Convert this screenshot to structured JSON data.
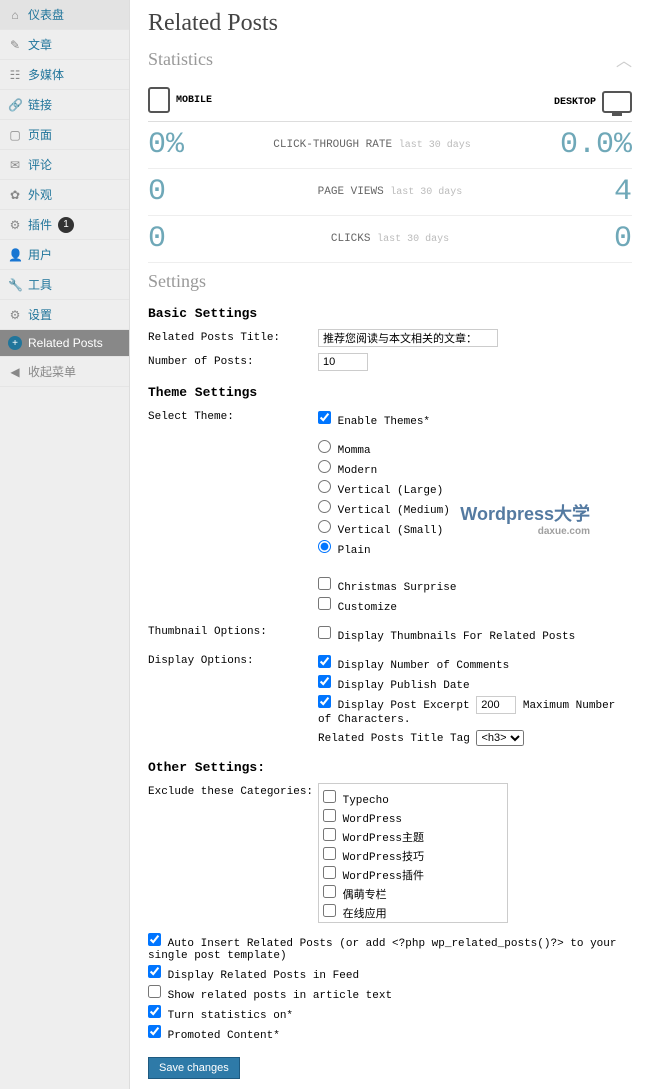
{
  "sidebar": {
    "items": [
      {
        "icon": "⌂",
        "label": "仪表盘"
      },
      {
        "icon": "✎",
        "label": "文章"
      },
      {
        "icon": "☷",
        "label": "多媒体"
      },
      {
        "icon": "🔗",
        "label": "链接"
      },
      {
        "icon": "▢",
        "label": "页面"
      },
      {
        "icon": "✉",
        "label": "评论"
      },
      {
        "icon": "✿",
        "label": "外观"
      },
      {
        "icon": "⚙",
        "label": "插件",
        "badge": "1"
      },
      {
        "icon": "👤",
        "label": "用户"
      },
      {
        "icon": "🔧",
        "label": "工具"
      },
      {
        "icon": "⚙",
        "label": "设置"
      }
    ],
    "active": {
      "icon": "+",
      "label": "Related Posts"
    },
    "collapse": "收起菜单"
  },
  "page_title": "Related Posts",
  "statistics": {
    "title": "Statistics",
    "mobile": "MOBILE",
    "desktop": "DESKTOP",
    "rows": [
      {
        "left": "0%",
        "label": "CLICK-THROUGH RATE",
        "days": "last 30 days",
        "right": "0.0%"
      },
      {
        "left": "0",
        "label": "PAGE VIEWS",
        "days": "last 30 days",
        "right": "4"
      },
      {
        "left": "0",
        "label": "CLICKS",
        "days": "last 30 days",
        "right": "0"
      }
    ]
  },
  "settings": {
    "title": "Settings",
    "basic": {
      "heading": "Basic Settings",
      "title_label": "Related Posts Title:",
      "title_value": "推荐您阅读与本文相关的文章：",
      "number_label": "Number of Posts:",
      "number_value": "10"
    },
    "theme": {
      "heading": "Theme Settings",
      "select_label": "Select Theme:",
      "enable": "Enable Themes*",
      "options": [
        "Momma",
        "Modern",
        "Vertical (Large)",
        "Vertical (Medium)",
        "Vertical (Small)",
        "Plain"
      ],
      "selected": "Plain",
      "christmas": "Christmas Surprise",
      "customize": "Customize",
      "thumb_label": "Thumbnail Options:",
      "thumb_opt": "Display Thumbnails For Related Posts",
      "display_label": "Display Options:",
      "d1": "Display Number of Comments",
      "d2": "Display Publish Date",
      "d3": "Display Post Excerpt",
      "excerpt_val": "200",
      "excerpt_text": "Maximum Number of Characters.",
      "tag_label": "Related Posts Title Tag",
      "tag_value": "<h3>"
    },
    "other": {
      "heading": "Other Settings:",
      "exclude_label": "Exclude these Categories:",
      "cats": [
        "Typecho",
        "WordPress",
        "WordPress主题",
        "WordPress技巧",
        "WordPress插件",
        "偶萌专栏",
        "在线应用"
      ]
    },
    "bottom": {
      "o1": "Auto Insert Related Posts (or add <?php wp_related_posts()?> to your single post template)",
      "o2": "Display Related Posts in Feed",
      "o3": "Show related posts in article text",
      "o4": "Turn statistics on*",
      "o5": "Promoted Content*"
    },
    "save": "Save changes"
  },
  "watermark": {
    "main": "Wordpress大学",
    "sub": "daxue.com"
  }
}
